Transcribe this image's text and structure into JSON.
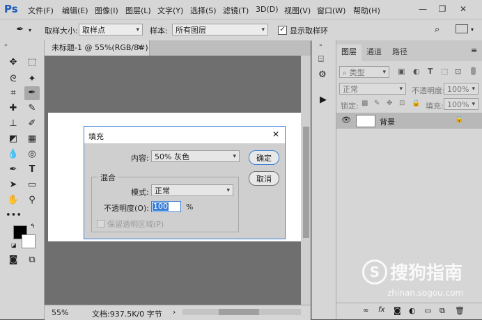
{
  "app": {
    "logo": "Ps"
  },
  "menu": [
    "文件(F)",
    "编辑(E)",
    "图像(I)",
    "图层(L)",
    "文字(Y)",
    "选择(S)",
    "滤镜(T)",
    "3D(D)",
    "视图(V)",
    "窗口(W)",
    "帮助(H)"
  ],
  "options": {
    "sample_size_label": "取样大小:",
    "sample_size_value": "取样点",
    "sample_label": "样本:",
    "sample_value": "所有图层",
    "show_ring_label": "显示取样环",
    "show_ring_checked": true
  },
  "document": {
    "tab_title": "未标题-1 @ 55%(RGB/8#)",
    "zoom": "55%",
    "doc_info": "文档:937.5K/0 字节"
  },
  "layers_panel": {
    "tabs": [
      "图层",
      "通道",
      "路径"
    ],
    "filter_kind": "类型",
    "blend_mode": "正常",
    "opacity_label": "不透明度:",
    "opacity_value": "100%",
    "lock_label": "锁定:",
    "fill_label": "填充:",
    "fill_value": "100%",
    "layer_name": "背景"
  },
  "dialog": {
    "title": "填充",
    "content_label": "内容:",
    "content_value": "50% 灰色",
    "ok_label": "确定",
    "cancel_label": "取消",
    "blend_group": "混合",
    "mode_label": "模式:",
    "mode_value": "正常",
    "opacity_label": "不透明度(O):",
    "opacity_value": "100",
    "opacity_unit": "%",
    "preserve_label": "保留透明区域(P)"
  },
  "watermark": {
    "text": "搜狗指南",
    "url": "zhinan.sogou.com"
  }
}
